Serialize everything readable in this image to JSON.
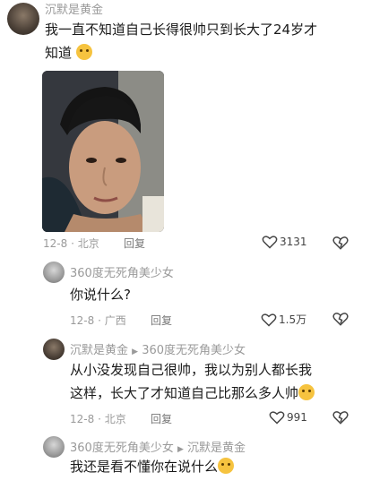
{
  "comments": [
    {
      "author": "沉默是黄金",
      "text_line1": "我一直不知道自己长得很帅只到长大了24岁才",
      "text_line2": "知道",
      "date": "12-8",
      "location": "北京",
      "reply_label": "回复",
      "likes": "3131",
      "emoji": "crying-laugh"
    },
    {
      "author": "360度无死角美少女",
      "text": "你说什么?",
      "date": "12-8",
      "location": "广西",
      "reply_label": "回复",
      "likes": "1.5万"
    },
    {
      "author": "沉默是黄金",
      "reply_to": "360度无死角美少女",
      "text_line1": "从小没发现自己很帅，我以为别人都长我",
      "text_line2": "这样，长大了才知道自己比那么多人帅",
      "date": "12-8",
      "location": "北京",
      "reply_label": "回复",
      "likes": "991",
      "emoji": "crying-laugh"
    },
    {
      "author": "360度无死角美少女",
      "reply_to": "沉默是黄金",
      "text": "我还是看不懂你在说什么"
    }
  ],
  "separator": "·",
  "reply_arrow": "▶"
}
